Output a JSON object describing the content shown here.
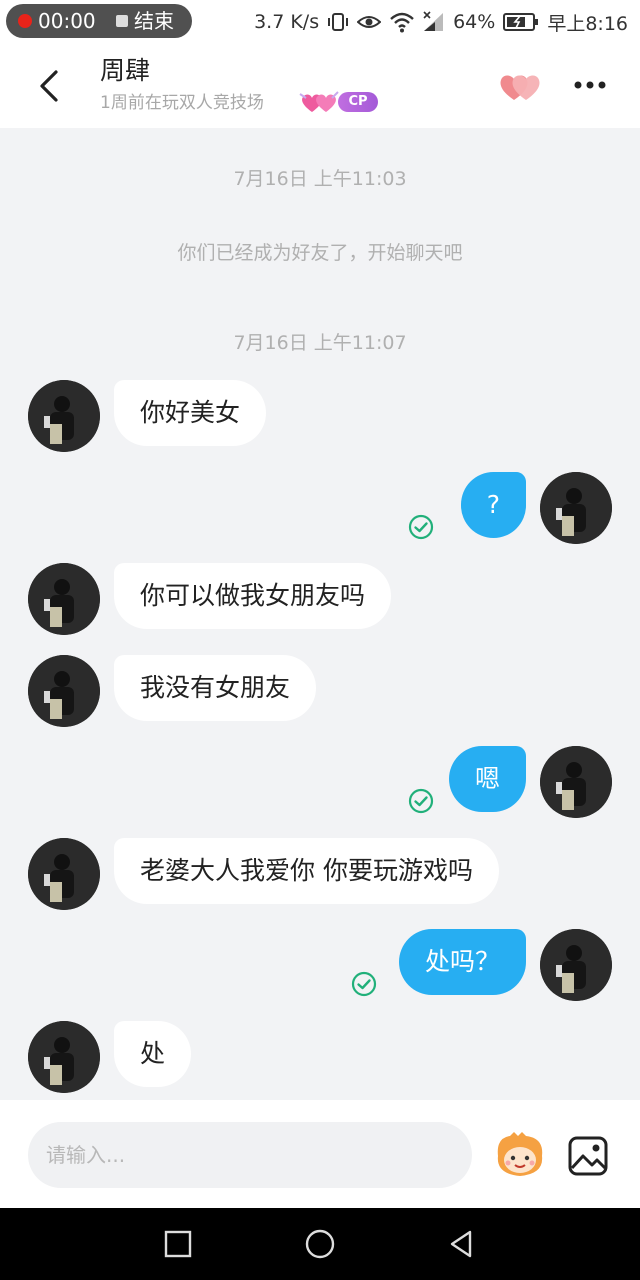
{
  "status_bar": {
    "record_time": "00:00",
    "record_end": "结束",
    "net_speed": "3.7 K/s",
    "battery": "64%",
    "time": "早上8:16"
  },
  "header": {
    "name": "周肆",
    "subtitle": "1周前在玩双人竞技场",
    "cp_badge": "CP"
  },
  "chat": {
    "time_1": "7月16日 上午11:03",
    "system_msg": "你们已经成为好友了，开始聊天吧",
    "time_2": "7月16日 上午11:07",
    "messages": [
      {
        "side": "in",
        "text": "你好美女"
      },
      {
        "side": "out",
        "text": "?"
      },
      {
        "side": "in",
        "text": "你可以做我女朋友吗"
      },
      {
        "side": "in",
        "text": "我没有女朋友"
      },
      {
        "side": "out",
        "text": "嗯"
      },
      {
        "side": "in",
        "text": "老婆大人我爱你 你要玩游戏吗"
      },
      {
        "side": "out",
        "text": "处吗？"
      },
      {
        "side": "in",
        "text": "处"
      }
    ]
  },
  "input": {
    "placeholder": "请输入..."
  },
  "colors": {
    "outgoing_bubble": "#27aef2",
    "incoming_bubble": "#ffffff",
    "chat_background": "#f2f3f5",
    "read_check": "#21b07a"
  }
}
